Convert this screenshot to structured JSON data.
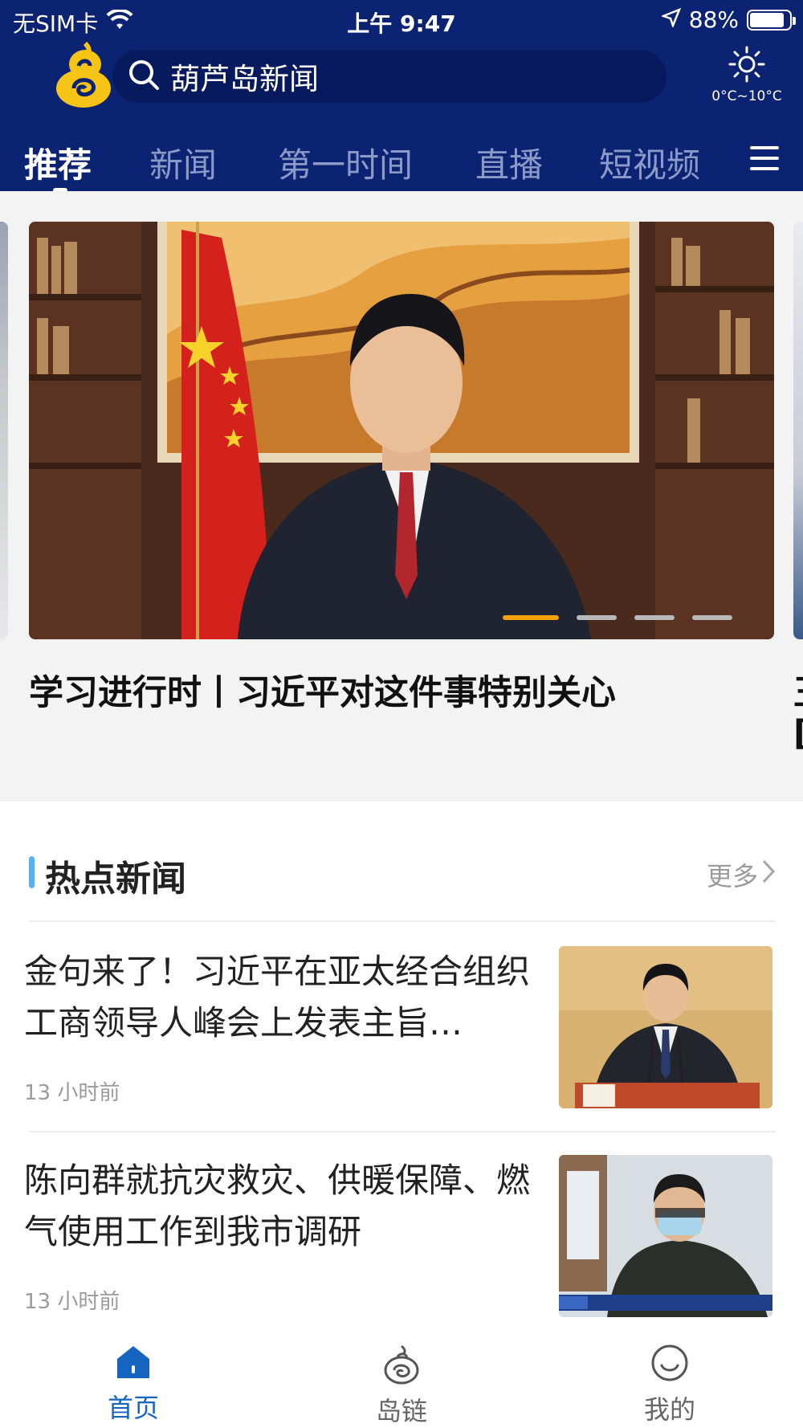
{
  "status_bar": {
    "carrier": "无SIM卡",
    "time": "上午 9:47",
    "battery": "88%",
    "battery_level": 0.88
  },
  "header": {
    "search_text": "葫芦岛新闻",
    "weather_temp": "0°C~10°C"
  },
  "tabs": [
    {
      "label": "推荐",
      "active": true
    },
    {
      "label": "新闻",
      "active": false
    },
    {
      "label": "第一时间",
      "active": false
    },
    {
      "label": "直播",
      "active": false
    },
    {
      "label": "短视频",
      "active": false
    }
  ],
  "carousel": {
    "title": "学习进行时丨习近平对这件事特别关心",
    "next_title_line1": "王",
    "next_title_line2": "[",
    "active_index": 0,
    "count": 4
  },
  "hot_news": {
    "title": "热点新闻",
    "more": "更多",
    "items": [
      {
        "title": "金句来了！习近平在亚太经合组织工商领导人峰会上发表主旨…",
        "time": "13 小时前"
      },
      {
        "title": "陈向群就抗灾救灾、供暖保障、燃气使用工作到我市调研",
        "time": "13 小时前"
      }
    ]
  },
  "tabbar": {
    "items": [
      {
        "label": "首页",
        "icon": "home-icon",
        "active": true
      },
      {
        "label": "岛链",
        "icon": "island-chain-icon",
        "active": false
      },
      {
        "label": "我的",
        "icon": "profile-icon",
        "active": false
      }
    ]
  },
  "colors": {
    "header_bg": "#0c2272",
    "accent_orange": "#f4a20c",
    "accent_blue": "#5aaef2",
    "tab_active": "#1565c0"
  }
}
